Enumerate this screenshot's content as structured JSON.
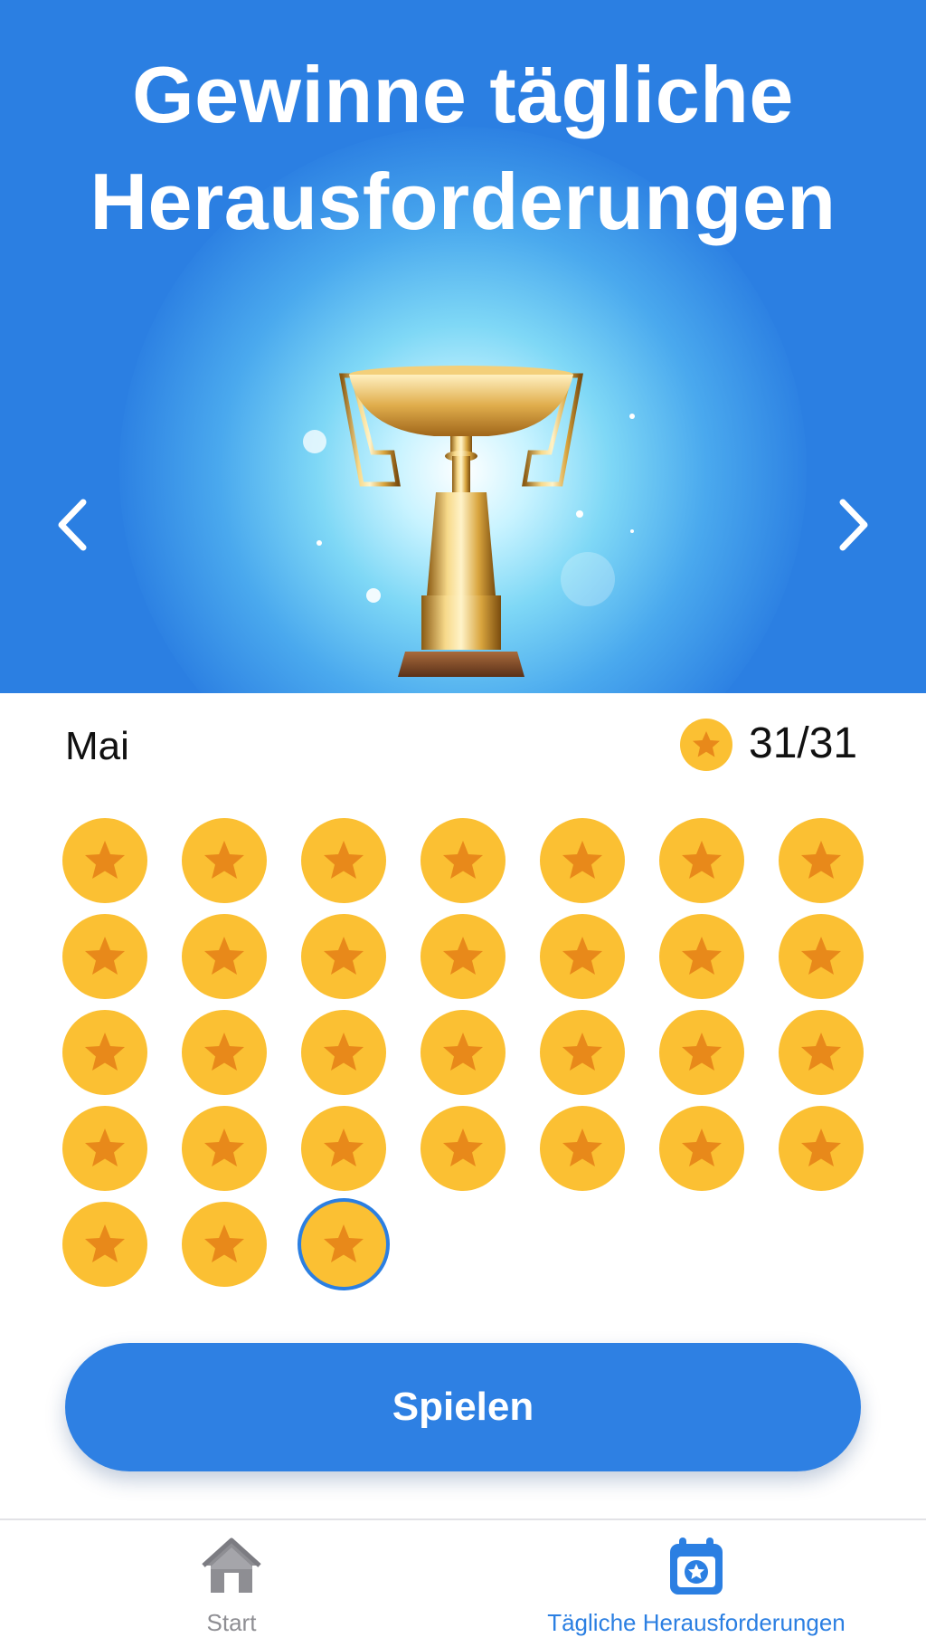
{
  "header": {
    "title_line1": "Gewinne tägliche",
    "title_line2": "Herausforderungen"
  },
  "month": {
    "label": "Mai",
    "score": "31/31"
  },
  "days": {
    "total": 31,
    "completed": 31,
    "selected_day": 31
  },
  "play_button": {
    "label": "Spielen"
  },
  "tabbar": {
    "home_label": "Start",
    "daily_label": "Tägliche Herausforderungen",
    "active_tab": "daily"
  },
  "colors": {
    "primary_blue": "#2B7FE2",
    "coin_yellow": "#FBC033",
    "star_orange": "#E8891A",
    "inactive_gray": "#8e8e93"
  },
  "icons": {
    "prev": "chevron-left-icon",
    "next": "chevron-right-icon",
    "trophy": "trophy-icon",
    "coin": "star-coin-icon",
    "home": "home-icon",
    "daily": "calendar-star-icon"
  }
}
